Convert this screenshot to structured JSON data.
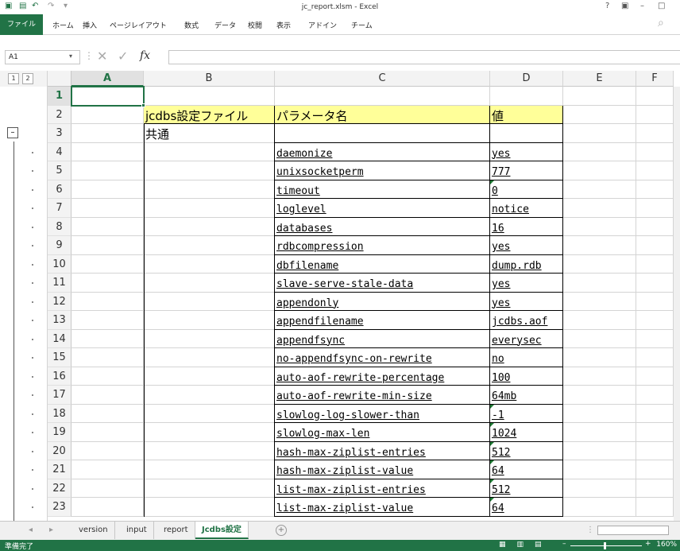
{
  "window": {
    "title": "jc_report.xlsm - Excel",
    "help_icon": "?",
    "minimize": "–",
    "maximize": "□"
  },
  "ribbon": {
    "file": "ファイル",
    "tabs": [
      "ホーム",
      "挿入",
      "ページレイアウト",
      "数式",
      "データ",
      "校閲",
      "表示",
      "アドイン",
      "チーム"
    ]
  },
  "formula_bar": {
    "name_box": "A1",
    "fx": "fx",
    "value": ""
  },
  "outline": {
    "levels": [
      "1",
      "2"
    ],
    "collapse": "–"
  },
  "columns": [
    "A",
    "B",
    "C",
    "D",
    "E",
    "F"
  ],
  "rows": [
    "1",
    "2",
    "3",
    "4",
    "5",
    "6",
    "7",
    "8",
    "9",
    "10",
    "11",
    "12",
    "13",
    "14",
    "15",
    "16",
    "17",
    "18",
    "19",
    "20",
    "21",
    "22",
    "23"
  ],
  "sheet": {
    "b2": "jcdbs設定ファイル",
    "c2": "パラメータ名",
    "d2": "値",
    "b3": "共通",
    "params": [
      {
        "row": "4",
        "name": "daemonize",
        "value": "yes"
      },
      {
        "row": "5",
        "name": "unixsocketperm",
        "value": "777"
      },
      {
        "row": "6",
        "name": "timeout",
        "value": "0"
      },
      {
        "row": "7",
        "name": "loglevel",
        "value": "notice"
      },
      {
        "row": "8",
        "name": "databases",
        "value": "16"
      },
      {
        "row": "9",
        "name": "rdbcompression",
        "value": "yes"
      },
      {
        "row": "10",
        "name": "dbfilename",
        "value": "dump.rdb"
      },
      {
        "row": "11",
        "name": "slave-serve-stale-data",
        "value": "yes"
      },
      {
        "row": "12",
        "name": "appendonly",
        "value": "yes"
      },
      {
        "row": "13",
        "name": "appendfilename",
        "value": "jcdbs.aof"
      },
      {
        "row": "14",
        "name": "appendfsync",
        "value": "everysec"
      },
      {
        "row": "15",
        "name": "no-appendfsync-on-rewrite",
        "value": "no"
      },
      {
        "row": "16",
        "name": "auto-aof-rewrite-percentage",
        "value": "100"
      },
      {
        "row": "17",
        "name": "auto-aof-rewrite-min-size",
        "value": "64mb"
      },
      {
        "row": "18",
        "name": "slowlog-log-slower-than",
        "value": "-1"
      },
      {
        "row": "19",
        "name": "slowlog-max-len",
        "value": "1024"
      },
      {
        "row": "20",
        "name": "hash-max-ziplist-entries",
        "value": "512"
      },
      {
        "row": "21",
        "name": "hash-max-ziplist-value",
        "value": "64"
      },
      {
        "row": "22",
        "name": "list-max-ziplist-entries",
        "value": "512"
      },
      {
        "row": "23",
        "name": "list-max-ziplist-value",
        "value": "64"
      }
    ]
  },
  "sheet_tabs": [
    "version",
    "input",
    "report",
    "Jcdbs設定"
  ],
  "active_sheet": "Jcdbs設定",
  "status": {
    "ready": "準備完了",
    "zoom": "160%"
  },
  "colors": {
    "accent": "#217346",
    "header_fill": "#ffff99"
  }
}
